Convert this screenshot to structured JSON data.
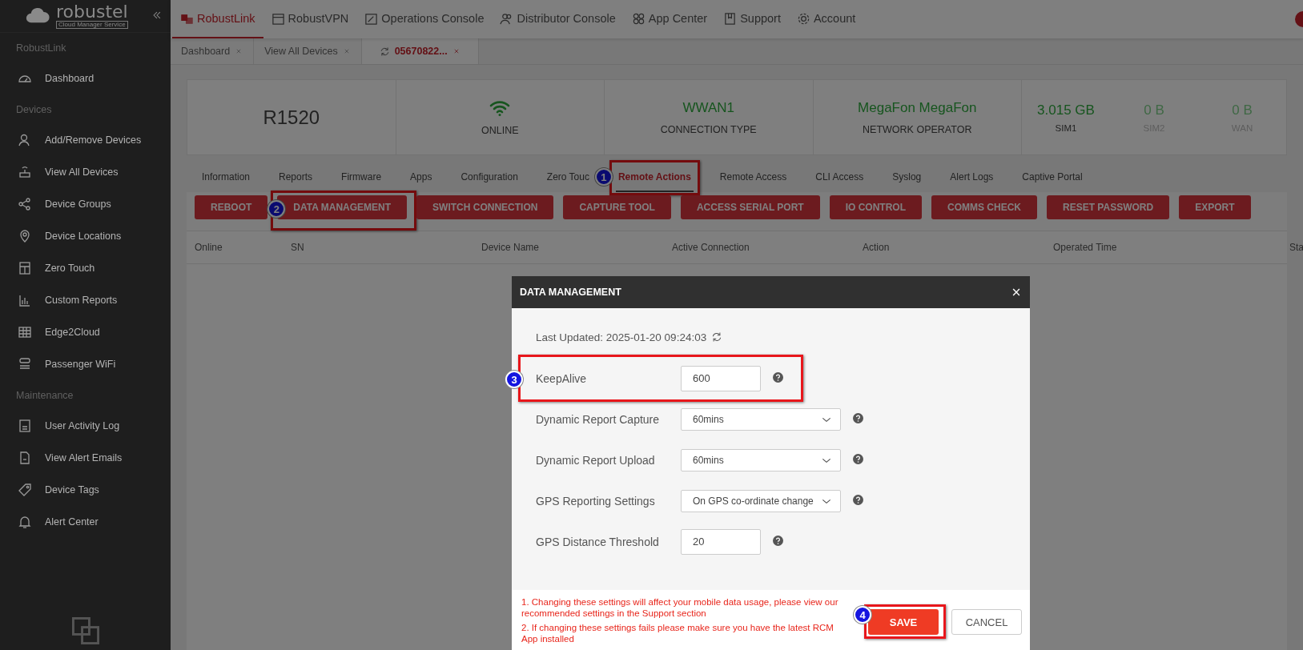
{
  "sidebar": {
    "logo": {
      "name": "robustel",
      "tagline": "Cloud Manager Service"
    },
    "sections": [
      {
        "label": "RobustLink",
        "items": [
          {
            "label": "Dashboard"
          }
        ]
      },
      {
        "label": "Devices",
        "items": [
          {
            "label": "Add/Remove Devices"
          },
          {
            "label": "View All Devices"
          },
          {
            "label": "Device Groups"
          },
          {
            "label": "Device Locations"
          },
          {
            "label": "Zero Touch"
          },
          {
            "label": "Custom Reports"
          },
          {
            "label": "Edge2Cloud"
          },
          {
            "label": "Passenger WiFi"
          }
        ]
      },
      {
        "label": "Maintenance",
        "items": [
          {
            "label": "User Activity Log"
          },
          {
            "label": "View Alert Emails"
          },
          {
            "label": "Device Tags"
          },
          {
            "label": "Alert Center"
          }
        ]
      }
    ]
  },
  "top_nav": [
    {
      "label": "RobustLink",
      "selected": true
    },
    {
      "label": "RobustVPN",
      "selected": false
    },
    {
      "label": "Operations Console",
      "selected": false
    },
    {
      "label": "Distributor Console",
      "selected": false
    },
    {
      "label": "App Center",
      "selected": false
    },
    {
      "label": "Support",
      "selected": false
    },
    {
      "label": "Account",
      "selected": false
    }
  ],
  "page_tabs": [
    {
      "label": "Dashboard",
      "selected": false,
      "loading": false
    },
    {
      "label": "View All Devices",
      "selected": false,
      "loading": false
    },
    {
      "label": "05670822...",
      "selected": true,
      "loading": true
    }
  ],
  "device_summary": {
    "model": "R1520",
    "status": "ONLINE",
    "connection": {
      "value": "WWAN1",
      "label": "CONNECTION TYPE"
    },
    "operator": {
      "value": "MegaFon MegaFon",
      "label": "NETWORK OPERATOR"
    },
    "usage": [
      {
        "value": "3.015 GB",
        "label": "SIM1",
        "active": true
      },
      {
        "value": "0 B",
        "label": "SIM2",
        "active": false
      },
      {
        "value": "0 B",
        "label": "WAN",
        "active": false
      }
    ]
  },
  "device_tabs": [
    {
      "label": "Information",
      "selected": false
    },
    {
      "label": "Reports",
      "selected": false
    },
    {
      "label": "Firmware",
      "selected": false
    },
    {
      "label": "Apps",
      "selected": false
    },
    {
      "label": "Configuration",
      "selected": false
    },
    {
      "label": "Zero Touc",
      "selected": false
    },
    {
      "label": "Remote Actions",
      "selected": true
    },
    {
      "label": "Remote Access",
      "selected": false
    },
    {
      "label": "CLI Access",
      "selected": false
    },
    {
      "label": "Syslog",
      "selected": false
    },
    {
      "label": "Alert Logs",
      "selected": false
    },
    {
      "label": "Captive Portal",
      "selected": false
    }
  ],
  "actions": [
    "REBOOT",
    "DATA MANAGEMENT",
    "SWITCH CONNECTION",
    "CAPTURE TOOL",
    "ACCESS SERIAL PORT",
    "IO CONTROL",
    "COMMS CHECK",
    "RESET PASSWORD",
    "EXPORT"
  ],
  "table": {
    "columns": [
      "Online",
      "SN",
      "Device Name",
      "Active Connection",
      "Action",
      "Operated Time",
      "Sta"
    ]
  },
  "dialog": {
    "title": "DATA MANAGEMENT",
    "last_updated": "Last Updated: 2025-01-20 09:24:03",
    "fields": [
      {
        "label": "KeepAlive",
        "kind": "input",
        "value": "600"
      },
      {
        "label": "Dynamic Report Capture",
        "kind": "select",
        "value": "60mins"
      },
      {
        "label": "Dynamic Report Upload",
        "kind": "select",
        "value": "60mins"
      },
      {
        "label": "GPS Reporting Settings",
        "kind": "select",
        "value": "On GPS co-ordinate change"
      },
      {
        "label": "GPS Distance Threshold",
        "kind": "input",
        "value": "20"
      }
    ],
    "notes": [
      "1. Changing these settings will affect your mobile data usage, please view our recommended settings in the Support section",
      "2. If changing these settings fails please make sure you have the latest RCM App installed"
    ],
    "buttons": [
      {
        "label": "SAVE",
        "kind": "primary"
      },
      {
        "label": "CANCEL",
        "kind": "secondary"
      }
    ]
  },
  "annotations": [
    {
      "number": "1"
    },
    {
      "number": "2"
    },
    {
      "number": "3"
    },
    {
      "number": "4"
    }
  ]
}
